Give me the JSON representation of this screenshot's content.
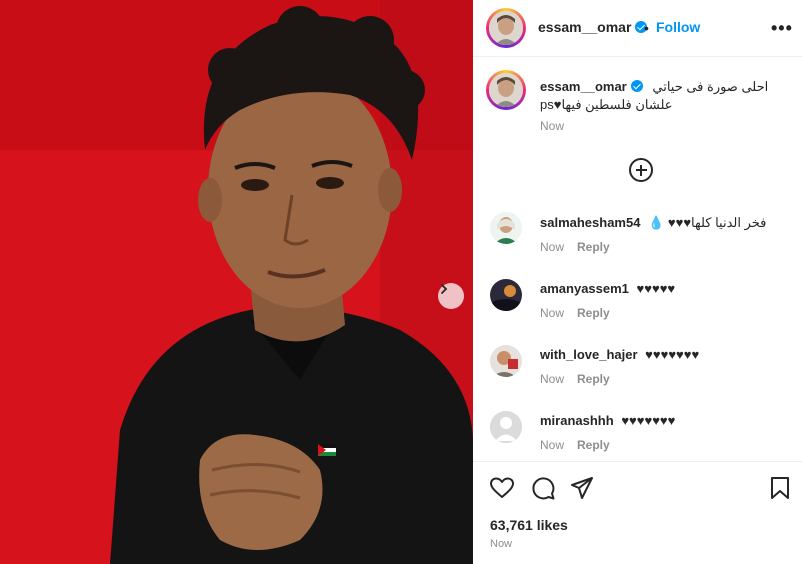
{
  "post": {
    "author": "essam__omar",
    "follow_label": "Follow",
    "dot": "•",
    "more_label": "•••"
  },
  "caption": {
    "author": "essam__omar",
    "line1": "احلى صورة فى حياتي",
    "line2": "علشان فلسطين فيها♥ps",
    "time": "Now"
  },
  "comments": [
    {
      "user": "salmahesham54",
      "text": "فخر الدنيا كلها♥♥♥ 💧",
      "time": "Now",
      "reply": "Reply"
    },
    {
      "user": "amanyassem1",
      "text": "♥♥♥♥♥",
      "time": "Now",
      "reply": "Reply"
    },
    {
      "user": "with_love_hajer",
      "text": "♥♥♥♥♥♥♥",
      "time": "Now",
      "reply": "Reply"
    },
    {
      "user": "miranashhh",
      "text": "♥♥♥♥♥♥♥",
      "time": "Now",
      "reply": "Reply"
    }
  ],
  "stats": {
    "likes": "63,761 likes",
    "posted": "Now"
  },
  "colors": {
    "accent": "#0095f6",
    "photo_background": "#d4101a"
  },
  "icons": {
    "like": "heart-icon",
    "comment": "comment-bubble-icon",
    "share": "paper-plane-icon",
    "save": "bookmark-icon",
    "next": "chevron-right-icon",
    "load_more": "plus-circle-icon"
  }
}
